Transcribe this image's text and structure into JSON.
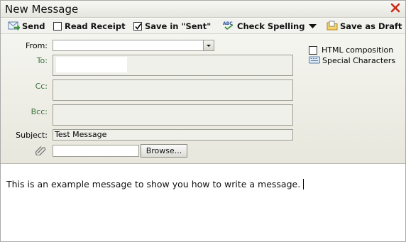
{
  "window": {
    "title": "New Message"
  },
  "toolbar": {
    "send": "Send",
    "read_receipt": "Read Receipt",
    "save_in_sent": "Save in \"Sent\"",
    "check_spelling": "Check Spelling",
    "save_as_draft": "Save as Draft"
  },
  "checkboxes": {
    "read_receipt_checked": false,
    "save_in_sent_checked": true,
    "html_composition_checked": false
  },
  "form": {
    "from_label": "From:",
    "from_value": "",
    "to_label": "To:",
    "cc_label": "Cc:",
    "bcc_label": "Bcc:",
    "subject_label": "Subject:",
    "subject_value": "Test Message",
    "attachment_value": "",
    "browse_label": "Browse..."
  },
  "options": {
    "html_composition": "HTML composition",
    "special_characters": "Special Characters"
  },
  "message": {
    "body": "This is an example message to show you how to write a message."
  },
  "colors": {
    "label_green": "#3a6e3a",
    "close_red": "#cc2a1a"
  }
}
